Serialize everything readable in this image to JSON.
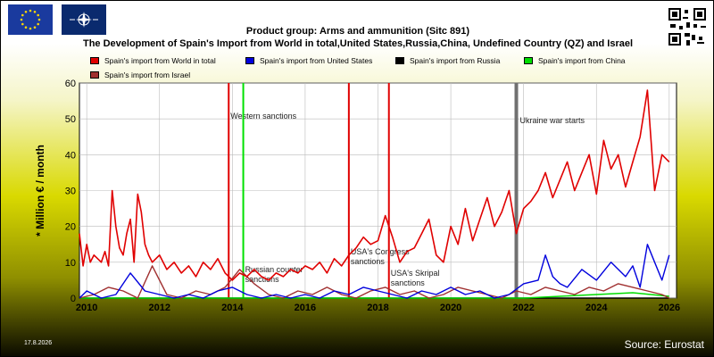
{
  "header": {
    "title": "Product group: Arms and ammunition (Sitc 891)",
    "subtitle": "The Development of Spain's Import from World in total,United States,Russia,China, Undefined Country (QZ) and Israel"
  },
  "footer": {
    "date": "17.8.2026",
    "source": "Source: Eurostat"
  },
  "colors": {
    "world": "#e00000",
    "us": "#0000dd",
    "russia": "#000000",
    "china": "#00dd00",
    "israel": "#a03030",
    "event_line_red": "#e00000",
    "event_line_green": "#00e000",
    "event_line_gray": "#707070"
  },
  "chart_data": {
    "type": "line",
    "ylabel": "* Million € / month",
    "ylim": [
      0,
      60
    ],
    "yticks": [
      "0",
      "10",
      "20",
      "30",
      "40",
      "50",
      "60"
    ],
    "xlim": [
      2009.8,
      2026.2
    ],
    "xticks": [
      "2010",
      "2012",
      "2014",
      "2016",
      "2018",
      "2020",
      "2022",
      "2024",
      "2026"
    ],
    "legend": [
      {
        "key": "world",
        "label": "Spain's import from World in total"
      },
      {
        "key": "us",
        "label": "Spain's import from United States"
      },
      {
        "key": "russia",
        "label": "Spain's import from Russia"
      },
      {
        "key": "china",
        "label": "Spain's import from China"
      },
      {
        "key": "israel",
        "label": "Spain's import from Israel"
      }
    ],
    "events": [
      {
        "x": 2013.9,
        "color": "red",
        "label": "Western sanctions"
      },
      {
        "x": 2014.3,
        "color": "green",
        "label": "Russian counter sanctions"
      },
      {
        "x": 2017.2,
        "color": "red",
        "label": "USA's Congress sanctions"
      },
      {
        "x": 2018.3,
        "color": "red",
        "label": "USA's Skripal sanctions"
      },
      {
        "x": 2021.8,
        "color": "gray",
        "label": "Ukraine war starts"
      }
    ],
    "series": [
      {
        "key": "world",
        "x": [
          2009.8,
          2009.9,
          2010.0,
          2010.1,
          2010.2,
          2010.3,
          2010.4,
          2010.5,
          2010.6,
          2010.7,
          2010.8,
          2010.9,
          2011.0,
          2011.1,
          2011.2,
          2011.3,
          2011.4,
          2011.5,
          2011.6,
          2011.7,
          2011.8,
          2011.9,
          2012.0,
          2012.2,
          2012.4,
          2012.6,
          2012.8,
          2013.0,
          2013.2,
          2013.4,
          2013.6,
          2013.8,
          2014.0,
          2014.2,
          2014.4,
          2014.6,
          2014.8,
          2015.0,
          2015.2,
          2015.4,
          2015.6,
          2015.8,
          2016.0,
          2016.2,
          2016.4,
          2016.6,
          2016.8,
          2017.0,
          2017.2,
          2017.4,
          2017.6,
          2017.8,
          2018.0,
          2018.2,
          2018.4,
          2018.6,
          2018.8,
          2019.0,
          2019.2,
          2019.4,
          2019.6,
          2019.8,
          2020.0,
          2020.2,
          2020.4,
          2020.6,
          2020.8,
          2021.0,
          2021.2,
          2021.4,
          2021.6,
          2021.8,
          2022.0,
          2022.2,
          2022.4,
          2022.6,
          2022.8,
          2023.0,
          2023.2,
          2023.4,
          2023.6,
          2023.8,
          2024.0,
          2024.2,
          2024.4,
          2024.6,
          2024.8,
          2025.0,
          2025.2,
          2025.4,
          2025.6,
          2025.8,
          2026.0
        ],
        "y": [
          18,
          9,
          15,
          10,
          12,
          11,
          10,
          13,
          9,
          30,
          20,
          14,
          12,
          18,
          22,
          10,
          29,
          24,
          15,
          12,
          10,
          11,
          12,
          8,
          10,
          7,
          9,
          6,
          10,
          8,
          11,
          7,
          5,
          7,
          6,
          8,
          6,
          5,
          7,
          6,
          8,
          7,
          9,
          8,
          10,
          7,
          11,
          9,
          12,
          14,
          17,
          15,
          16,
          23,
          17,
          10,
          13,
          14,
          18,
          22,
          12,
          10,
          20,
          15,
          25,
          16,
          22,
          28,
          20,
          24,
          30,
          18,
          25,
          27,
          30,
          35,
          28,
          33,
          38,
          30,
          35,
          40,
          29,
          44,
          36,
          40,
          31,
          38,
          45,
          58,
          30,
          40,
          38
        ]
      },
      {
        "key": "us",
        "x": [
          2009.8,
          2010.0,
          2010.4,
          2010.8,
          2011.2,
          2011.6,
          2012.0,
          2012.4,
          2012.8,
          2013.2,
          2013.6,
          2014.0,
          2014.4,
          2014.8,
          2015.2,
          2015.6,
          2016.0,
          2016.4,
          2016.8,
          2017.2,
          2017.6,
          2018.0,
          2018.4,
          2018.8,
          2019.2,
          2019.6,
          2020.0,
          2020.4,
          2020.8,
          2021.2,
          2021.6,
          2022.0,
          2022.4,
          2022.6,
          2022.8,
          2023.0,
          2023.2,
          2023.6,
          2024.0,
          2024.4,
          2024.8,
          2025.0,
          2025.2,
          2025.4,
          2025.6,
          2025.8,
          2026.0
        ],
        "y": [
          0,
          2,
          0,
          1,
          7,
          2,
          1,
          0,
          1,
          0,
          2,
          3,
          1,
          0,
          1,
          0,
          1,
          0,
          2,
          1,
          3,
          2,
          1,
          0,
          2,
          1,
          3,
          1,
          2,
          0,
          1,
          4,
          5,
          12,
          6,
          4,
          3,
          8,
          5,
          10,
          6,
          9,
          3,
          15,
          10,
          5,
          12
        ]
      },
      {
        "key": "israel",
        "x": [
          2009.8,
          2010.2,
          2010.6,
          2011.0,
          2011.4,
          2011.8,
          2012.2,
          2012.6,
          2013.0,
          2013.4,
          2013.8,
          2014.2,
          2014.6,
          2015.0,
          2015.4,
          2015.8,
          2016.2,
          2016.6,
          2017.0,
          2017.4,
          2017.8,
          2018.2,
          2018.6,
          2019.0,
          2019.4,
          2019.8,
          2020.2,
          2020.6,
          2021.0,
          2021.4,
          2021.8,
          2022.2,
          2022.6,
          2023.0,
          2023.4,
          2023.8,
          2024.2,
          2024.6,
          2025.0,
          2025.4,
          2025.8,
          2026.0
        ],
        "y": [
          0,
          1,
          3,
          2,
          0,
          9,
          1,
          0,
          2,
          1,
          3,
          8,
          4,
          1,
          0,
          2,
          1,
          3,
          1,
          0,
          2,
          3,
          1,
          2,
          0,
          1,
          3,
          2,
          1,
          0,
          2,
          1,
          3,
          2,
          1,
          3,
          2,
          4,
          3,
          2,
          1,
          0
        ]
      },
      {
        "key": "china",
        "x": [
          2009.8,
          2012,
          2014,
          2016,
          2018,
          2020,
          2022,
          2023,
          2024,
          2025,
          2026
        ],
        "y": [
          0,
          0,
          0,
          0,
          0,
          0,
          0,
          0.5,
          1,
          1.5,
          0.5
        ]
      },
      {
        "key": "russia",
        "x": [
          2009.8,
          2026.0
        ],
        "y": [
          0,
          0
        ]
      }
    ]
  }
}
